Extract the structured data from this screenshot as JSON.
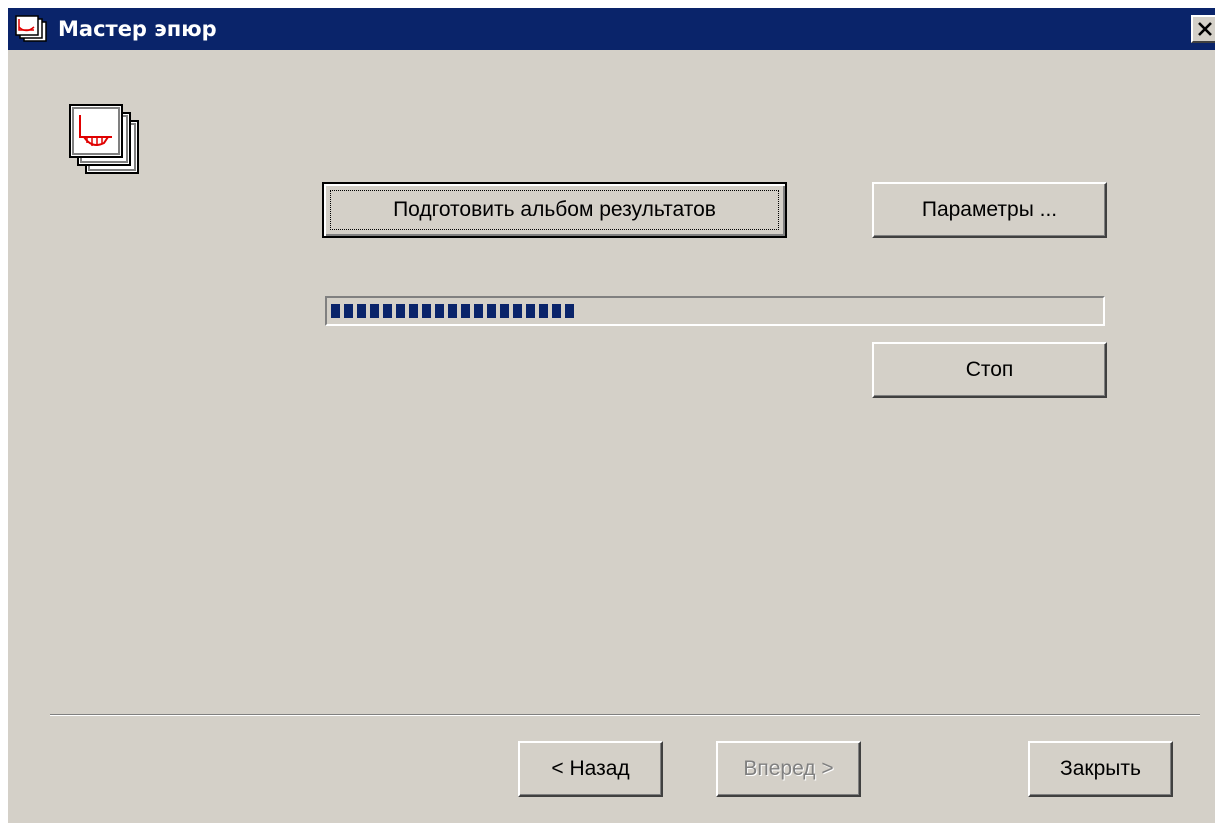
{
  "window": {
    "title": "Мастер эпюр",
    "icons": {
      "app": "wizard-diagrams-icon",
      "close": "close-x-icon",
      "wizard": "stacked-diagram-pages-icon"
    }
  },
  "actions": {
    "prepare_label": "Подготовить альбом результатов",
    "params_label": "Параметры ...",
    "stop_label": "Стоп"
  },
  "progress": {
    "fraction": 0.33,
    "color": "#0a246a"
  },
  "footer": {
    "back_label": "< Назад",
    "next_label": "Вперед >",
    "close_label": "Закрыть"
  },
  "colors": {
    "titlebar": "#0a246a",
    "face": "#d4d0c8",
    "diagram": "#e00000"
  }
}
